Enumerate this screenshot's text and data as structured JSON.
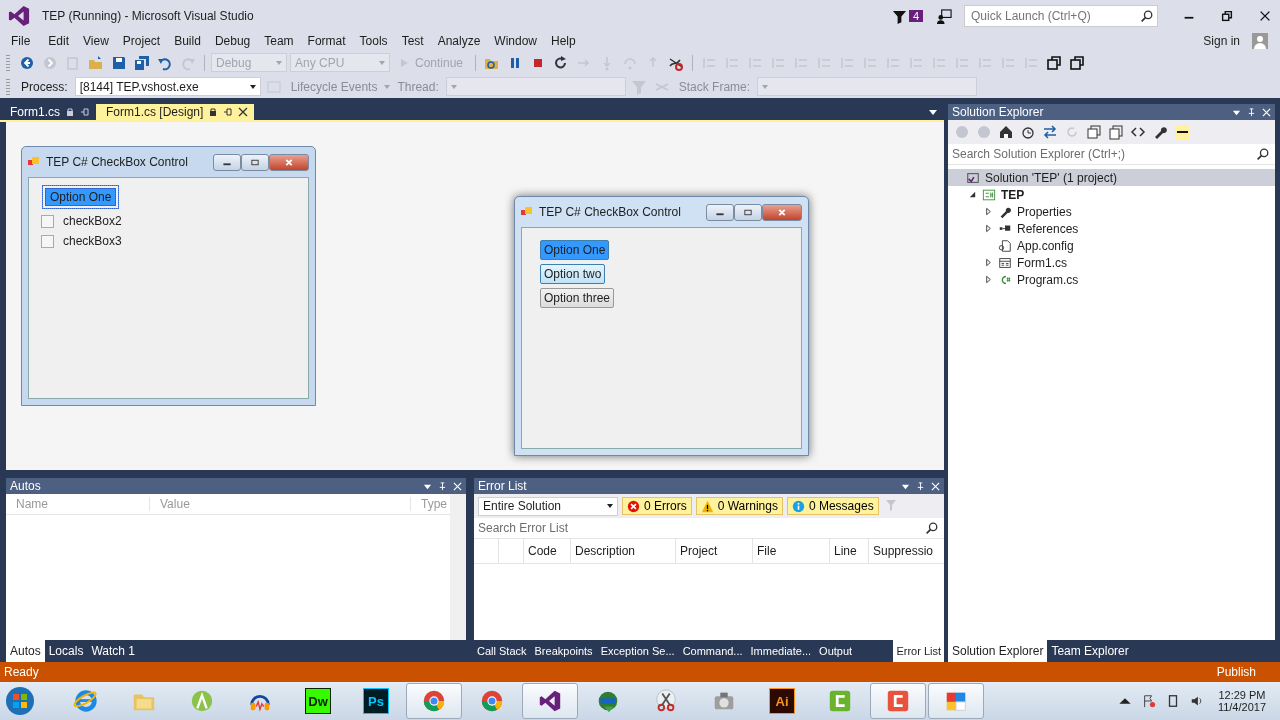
{
  "window": {
    "title": "TEP (Running) - Microsoft Visual Studio",
    "notification_count": "4",
    "quick_launch": {
      "placeholder": "Quick Launch (Ctrl+Q)"
    }
  },
  "menu": [
    "File",
    "Edit",
    "View",
    "Project",
    "Build",
    "Debug",
    "Team",
    "Format",
    "Tools",
    "Test",
    "Analyze",
    "Window",
    "Help"
  ],
  "sign_in": "Sign in",
  "toolbar": {
    "configuration": "Debug",
    "platform": "Any CPU",
    "continue": "Continue"
  },
  "debug_location": {
    "process_label": "Process:",
    "process": "[8144] TEP.vshost.exe",
    "lifecycle": "Lifecycle Events",
    "thread_label": "Thread:",
    "stack_frame_label": "Stack Frame:"
  },
  "document_tabs": [
    {
      "label": "Form1.cs",
      "selected": false
    },
    {
      "label": "Form1.cs [Design]",
      "selected": true
    }
  ],
  "designer_form": {
    "title": "TEP C# CheckBox Control",
    "controls": [
      {
        "kind": "toggle",
        "label": "Option One",
        "checked": true,
        "selected": true
      },
      {
        "kind": "checkbox",
        "label": "checkBox2",
        "checked": false,
        "selected": false
      },
      {
        "kind": "checkbox",
        "label": "checkBox3",
        "checked": false,
        "selected": false
      }
    ]
  },
  "running_form": {
    "title": "TEP C# CheckBox Control",
    "buttons": [
      {
        "label": "Option One",
        "checked": true,
        "hovered": false
      },
      {
        "label": "Option two",
        "checked": false,
        "hovered": true
      },
      {
        "label": "Option three",
        "checked": false,
        "hovered": false
      }
    ]
  },
  "autos": {
    "title": "Autos",
    "columns": [
      "Name",
      "Value",
      "Type"
    ],
    "tabs": [
      {
        "label": "Autos",
        "selected": true
      },
      {
        "label": "Locals",
        "selected": false
      },
      {
        "label": "Watch 1",
        "selected": false
      }
    ]
  },
  "error_list": {
    "title": "Error List",
    "scope": "Entire Solution",
    "filters": [
      {
        "kind": "error",
        "label": "0 Errors"
      },
      {
        "kind": "warning",
        "label": "0 Warnings"
      },
      {
        "kind": "message",
        "label": "0 Messages"
      }
    ],
    "search": {
      "placeholder": "Search Error List"
    },
    "columns": [
      "Code",
      "Description",
      "Project",
      "File",
      "Line",
      "Suppressio"
    ]
  },
  "bottom_tabs": [
    {
      "label": "Call Stack",
      "selected": false
    },
    {
      "label": "Breakpoints",
      "selected": false
    },
    {
      "label": "Exception Se...",
      "selected": false
    },
    {
      "label": "Command...",
      "selected": false
    },
    {
      "label": "Immediate...",
      "selected": false
    },
    {
      "label": "Output",
      "selected": false
    },
    {
      "label": "Error List",
      "selected": true
    }
  ],
  "solution_explorer": {
    "title": "Solution Explorer",
    "search": {
      "placeholder": "Search Solution Explorer (Ctrl+;)"
    },
    "tree": [
      {
        "label": "Solution 'TEP' (1 project)",
        "kind": "solution",
        "selected": true,
        "children": [
          {
            "label": "TEP",
            "kind": "project",
            "expanded": true,
            "selected": false,
            "children": [
              {
                "label": "Properties",
                "kind": "properties",
                "expanded": false,
                "selected": false
              },
              {
                "label": "References",
                "kind": "references",
                "expanded": false,
                "selected": false
              },
              {
                "label": "App.config",
                "kind": "config",
                "selected": false
              },
              {
                "label": "Form1.cs",
                "kind": "form",
                "expanded": false,
                "selected": false
              },
              {
                "label": "Program.cs",
                "kind": "csharp",
                "expanded": false,
                "selected": false
              }
            ]
          }
        ]
      }
    ],
    "tabs": [
      {
        "label": "Solution Explorer",
        "selected": true
      },
      {
        "label": "Team Explorer",
        "selected": false
      }
    ]
  },
  "status_bar": {
    "text": "Ready",
    "publish": "Publish"
  },
  "taskbar": {
    "apps": [
      {
        "kind": "ie",
        "active": false
      },
      {
        "kind": "folder",
        "active": false
      },
      {
        "kind": "android",
        "active": false
      },
      {
        "kind": "audio",
        "active": false
      },
      {
        "kind": "dreamweaver",
        "label": "Dw",
        "active": false
      },
      {
        "kind": "photoshop",
        "label": "Ps",
        "active": false
      },
      {
        "kind": "chrome",
        "active": true
      },
      {
        "kind": "chrome",
        "active": false
      },
      {
        "kind": "visualstudio",
        "active": true
      },
      {
        "kind": "download",
        "active": false
      },
      {
        "kind": "snip",
        "active": false
      },
      {
        "kind": "camera",
        "active": false
      },
      {
        "kind": "illustrator",
        "label": "Ai",
        "active": false
      },
      {
        "kind": "camtasia",
        "active": false
      },
      {
        "kind": "camtasia",
        "active": true
      },
      {
        "kind": "windows",
        "active": true
      }
    ],
    "time": "12:29 PM",
    "date": "11/4/2017"
  }
}
